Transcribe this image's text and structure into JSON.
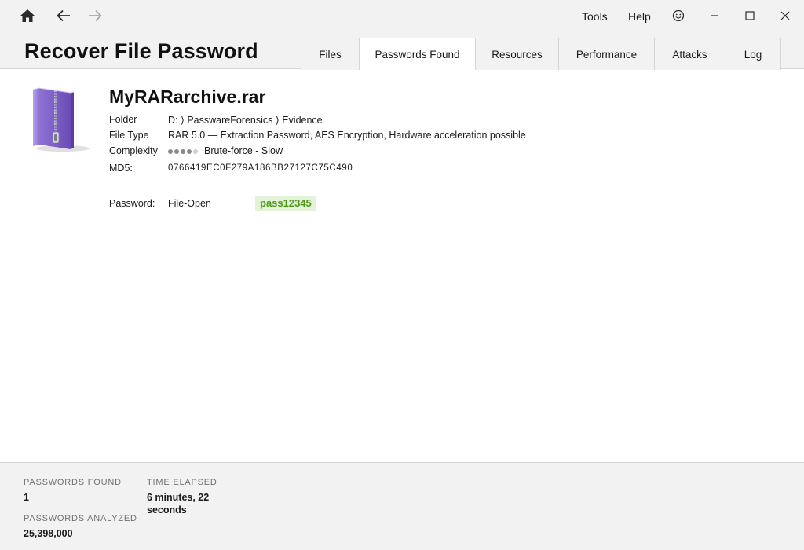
{
  "menu": {
    "tools_label": "Tools",
    "help_label": "Help"
  },
  "header": {
    "title": "Recover File Password",
    "tabs": [
      {
        "label": "Files",
        "active": false
      },
      {
        "label": "Passwords Found",
        "active": true
      },
      {
        "label": "Resources",
        "active": false
      },
      {
        "label": "Performance",
        "active": false
      },
      {
        "label": "Attacks",
        "active": false
      },
      {
        "label": "Log",
        "active": false
      }
    ]
  },
  "file": {
    "name": "MyRARarchive.rar",
    "icon": "rar-archive-icon",
    "folder_label": "Folder",
    "folder_value": "D: ⟩ PasswareForensics ⟩ Evidence",
    "filetype_label": "File Type",
    "filetype_value": "RAR 5.0 — Extraction Password, AES Encryption, Hardware acceleration possible",
    "complexity_label": "Complexity",
    "complexity_level": 4,
    "complexity_max": 5,
    "complexity_value": "Brute-force - Slow",
    "md5_label": "MD5:",
    "md5_value": "0766419EC0F279A186BB27127C75C490"
  },
  "password": {
    "label": "Password:",
    "type": "File-Open",
    "value": "pass12345"
  },
  "stats": {
    "passwords_found_label": "PASSWORDS FOUND",
    "passwords_found_value": "1",
    "time_elapsed_label": "TIME ELAPSED",
    "time_elapsed_value_line1": "6 minutes, 22",
    "time_elapsed_value_line2": "seconds",
    "passwords_analyzed_label": "PASSWORDS ANALYZED",
    "passwords_analyzed_value": "25,398,000"
  },
  "colors": {
    "chrome_bg": "#f2f2f2",
    "password_green": "#4d9a1d",
    "password_badge_bg": "#e3f2d8",
    "archive_purple": "#7b5cc4"
  }
}
